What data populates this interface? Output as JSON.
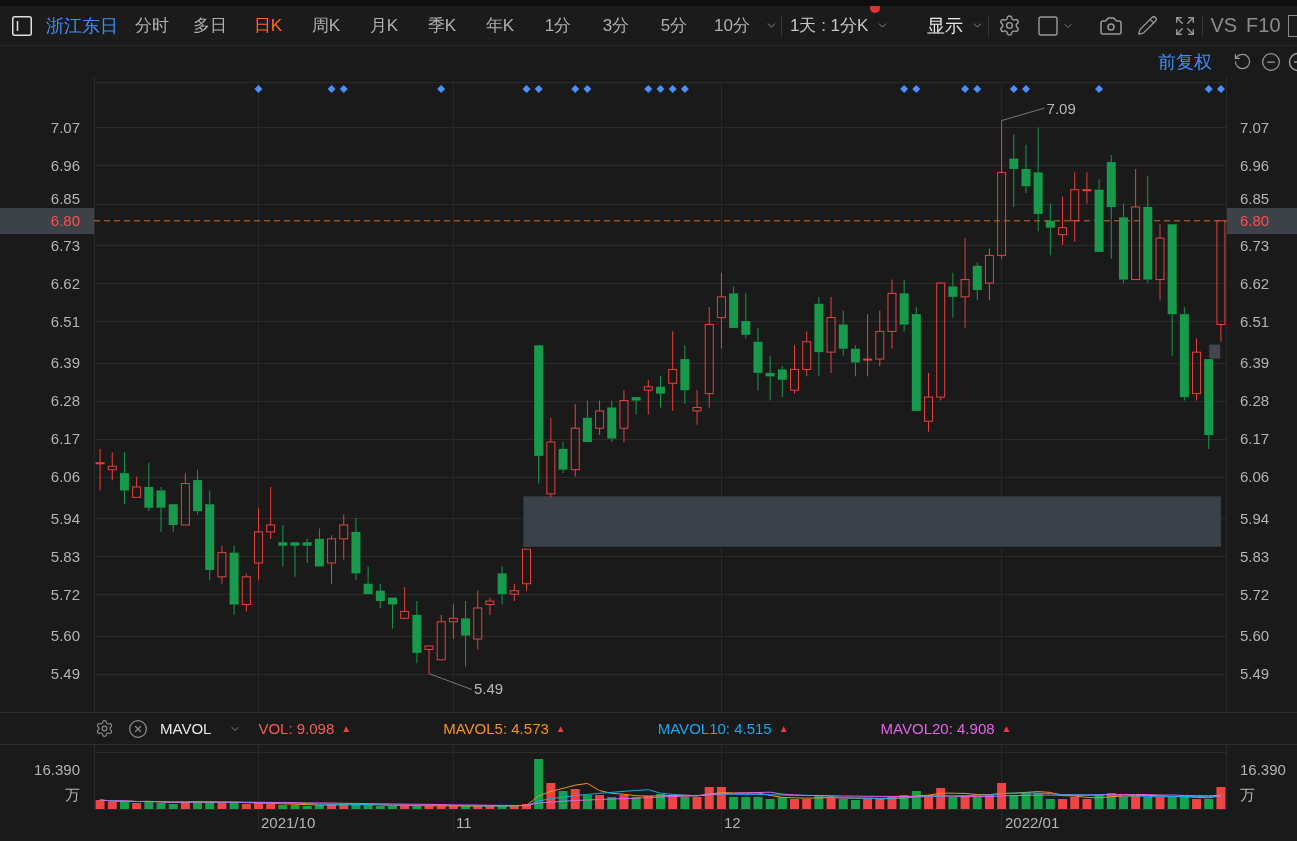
{
  "toolbar": {
    "stock_name": "浙江东日",
    "periods": [
      {
        "label": "分时",
        "selected": false
      },
      {
        "label": "多日",
        "selected": false
      },
      {
        "label": "日K",
        "selected": true
      },
      {
        "label": "周K",
        "selected": false
      },
      {
        "label": "月K",
        "selected": false
      },
      {
        "label": "季K",
        "selected": false
      },
      {
        "label": "年K",
        "selected": false
      },
      {
        "label": "1分",
        "selected": false
      },
      {
        "label": "3分",
        "selected": false
      },
      {
        "label": "5分",
        "selected": false
      },
      {
        "label": "10分",
        "selected": false
      }
    ],
    "interval": {
      "label": "1天 : 1分K",
      "alert": true
    },
    "display_menu": "显示",
    "compare": "VS",
    "f10": "F10"
  },
  "subbar": {
    "adjustment": "前复权"
  },
  "price_chart": {
    "left_axis": {
      "current_price": "6.80"
    },
    "right_axis": {
      "ticks": [
        "7.07",
        "6.96",
        "6.85",
        "6.73",
        "6.62",
        "6.51",
        "6.39",
        "6.28",
        "6.17",
        "6.06",
        "5.94",
        "5.83",
        "5.72",
        "5.60",
        "5.49"
      ],
      "current_price": "6.80"
    },
    "high_label": "7.09",
    "low_label": "5.49",
    "chart_data": {
      "type": "candlestick",
      "grid": true,
      "ylim": [
        5.379,
        7.216
      ],
      "yticks": [
        7.07,
        6.96,
        6.85,
        6.73,
        6.62,
        6.51,
        6.39,
        6.28,
        6.17,
        6.06,
        5.94,
        5.83,
        5.72,
        {
          "value": 5.6,
          "label": "5.60"
        },
        5.49
      ],
      "ref_lines": [
        {
          "axis": "y",
          "value": 6.8
        }
      ],
      "categories": [
        null,
        null,
        null,
        null,
        null,
        null,
        null,
        null,
        null,
        null,
        null,
        null,
        null,
        null,
        null,
        null,
        null,
        null,
        null,
        null,
        null,
        null,
        null,
        null,
        null,
        null,
        null,
        null,
        null,
        null,
        null,
        null,
        null,
        null,
        null,
        null,
        null,
        null,
        null,
        null,
        null,
        null,
        null,
        null,
        null,
        null,
        null,
        null,
        null,
        null,
        null,
        null,
        null,
        null,
        null,
        null,
        null,
        null,
        null,
        null,
        null,
        null,
        null,
        null,
        null,
        null,
        null,
        null,
        null,
        null,
        null,
        null,
        null,
        null,
        null,
        null,
        null,
        null,
        null,
        null,
        null,
        null,
        null,
        null,
        null,
        null,
        null,
        null,
        null,
        null,
        null,
        null,
        null
      ],
      "ohlc": [
        [
          6.1,
          6.14,
          6.02,
          6.1
        ],
        [
          6.08,
          6.13,
          6.05,
          6.09
        ],
        [
          6.07,
          6.13,
          5.98,
          6.02
        ],
        [
          6.0,
          6.06,
          6.0,
          6.03
        ],
        [
          6.03,
          6.1,
          5.96,
          5.97
        ],
        [
          6.02,
          6.03,
          5.9,
          5.97
        ],
        [
          5.98,
          5.98,
          5.9,
          5.92
        ],
        [
          5.92,
          6.07,
          5.92,
          6.04
        ],
        [
          6.05,
          6.08,
          5.95,
          5.96
        ],
        [
          5.98,
          6.02,
          5.76,
          5.79
        ],
        [
          5.77,
          5.86,
          5.75,
          5.84
        ],
        [
          5.84,
          5.86,
          5.66,
          5.69
        ],
        [
          5.69,
          5.78,
          5.67,
          5.77
        ],
        [
          5.81,
          5.97,
          5.76,
          5.9
        ],
        [
          5.9,
          6.03,
          5.88,
          5.92
        ],
        [
          5.87,
          5.92,
          5.8,
          5.86
        ],
        [
          5.87,
          5.87,
          5.77,
          5.86
        ],
        [
          5.87,
          5.88,
          5.81,
          5.86
        ],
        [
          5.88,
          5.91,
          5.8,
          5.8
        ],
        [
          5.81,
          5.89,
          5.75,
          5.88
        ],
        [
          5.88,
          5.95,
          5.82,
          5.92
        ],
        [
          5.9,
          5.94,
          5.76,
          5.78
        ],
        [
          5.75,
          5.8,
          5.72,
          5.72
        ],
        [
          5.73,
          5.75,
          5.68,
          5.7
        ],
        [
          5.71,
          5.71,
          5.62,
          5.69
        ],
        [
          5.65,
          5.74,
          5.65,
          5.67
        ],
        [
          5.66,
          5.7,
          5.52,
          5.55
        ],
        [
          5.56,
          5.57,
          5.49,
          5.57
        ],
        [
          5.53,
          5.66,
          5.53,
          5.64
        ],
        [
          5.64,
          5.69,
          5.59,
          5.65
        ],
        [
          5.65,
          5.7,
          5.51,
          5.6
        ],
        [
          5.59,
          5.73,
          5.56,
          5.68
        ],
        [
          5.69,
          5.71,
          5.66,
          5.7
        ],
        [
          5.78,
          5.8,
          5.69,
          5.72
        ],
        [
          5.72,
          5.75,
          5.7,
          5.73
        ],
        [
          5.75,
          5.85,
          5.73,
          5.85
        ],
        [
          6.44,
          6.44,
          6.04,
          6.12
        ],
        [
          6.01,
          6.23,
          6.0,
          6.16
        ],
        [
          6.14,
          6.16,
          6.07,
          6.08
        ],
        [
          6.08,
          6.27,
          6.06,
          6.2
        ],
        [
          6.23,
          6.28,
          6.16,
          6.16
        ],
        [
          6.2,
          6.28,
          6.18,
          6.25
        ],
        [
          6.26,
          6.28,
          6.16,
          6.17
        ],
        [
          6.2,
          6.31,
          6.16,
          6.28
        ],
        [
          6.29,
          6.29,
          6.24,
          6.28
        ],
        [
          6.31,
          6.34,
          6.24,
          6.32
        ],
        [
          6.32,
          6.35,
          6.26,
          6.3
        ],
        [
          6.33,
          6.48,
          6.25,
          6.37
        ],
        [
          6.4,
          6.44,
          6.27,
          6.31
        ],
        [
          6.25,
          6.31,
          6.21,
          6.26
        ],
        [
          6.3,
          6.55,
          6.26,
          6.5
        ],
        [
          6.52,
          6.65,
          6.43,
          6.58
        ],
        [
          6.59,
          6.61,
          6.49,
          6.49
        ],
        [
          6.51,
          6.59,
          6.46,
          6.47
        ],
        [
          6.45,
          6.49,
          6.31,
          6.36
        ],
        [
          6.36,
          6.41,
          6.28,
          6.35
        ],
        [
          6.37,
          6.38,
          6.29,
          6.34
        ],
        [
          6.31,
          6.44,
          6.3,
          6.37
        ],
        [
          6.37,
          6.48,
          6.35,
          6.45
        ],
        [
          6.56,
          6.58,
          6.35,
          6.42
        ],
        [
          6.42,
          6.58,
          6.36,
          6.52
        ],
        [
          6.5,
          6.54,
          6.41,
          6.43
        ],
        [
          6.43,
          6.44,
          6.35,
          6.39
        ],
        [
          6.4,
          6.53,
          6.35,
          6.4
        ],
        [
          6.4,
          6.54,
          6.38,
          6.48
        ],
        [
          6.48,
          6.63,
          6.43,
          6.59
        ],
        [
          6.59,
          6.63,
          6.48,
          6.5
        ],
        [
          6.53,
          6.55,
          6.25,
          6.25
        ],
        [
          6.22,
          6.36,
          6.19,
          6.29
        ],
        [
          6.29,
          6.62,
          6.28,
          6.62
        ],
        [
          6.61,
          6.65,
          6.52,
          6.58
        ],
        [
          6.58,
          6.75,
          6.49,
          6.63
        ],
        [
          6.67,
          6.68,
          6.57,
          6.6
        ],
        [
          6.62,
          6.72,
          6.57,
          6.7
        ],
        [
          6.7,
          7.09,
          6.69,
          6.94
        ],
        [
          6.98,
          7.05,
          6.84,
          6.95
        ],
        [
          6.95,
          7.02,
          6.88,
          6.9
        ],
        [
          6.94,
          7.07,
          6.77,
          6.82
        ],
        [
          6.8,
          6.85,
          6.7,
          6.78
        ],
        [
          6.76,
          6.87,
          6.73,
          6.78
        ],
        [
          6.8,
          6.94,
          6.74,
          6.89
        ],
        [
          6.89,
          6.94,
          6.85,
          6.89
        ],
        [
          6.89,
          6.92,
          6.71,
          6.71
        ],
        [
          6.97,
          6.99,
          6.69,
          6.84
        ],
        [
          6.81,
          6.85,
          6.62,
          6.63
        ],
        [
          6.63,
          6.95,
          6.63,
          6.84
        ],
        [
          6.84,
          6.93,
          6.62,
          6.63
        ],
        [
          6.63,
          6.79,
          6.57,
          6.75
        ],
        [
          6.79,
          6.79,
          6.41,
          6.53
        ],
        [
          6.53,
          6.55,
          6.28,
          6.29
        ],
        [
          6.3,
          6.46,
          6.28,
          6.42
        ],
        [
          6.4,
          6.4,
          6.14,
          6.18
        ],
        [
          6.5,
          6.8,
          6.45,
          6.8
        ]
      ]
    }
  },
  "indicator_bar": {
    "name": "MAVOL",
    "values": [
      {
        "text": "VOL: 9.098",
        "color": "#f25c5c",
        "mark": "▲"
      },
      {
        "text": "MAVOL5: 4.573",
        "color": "#f4921f",
        "mark": "▲"
      },
      {
        "text": "MAVOL10: 4.515",
        "color": "#1ea6ec",
        "mark": "▲"
      },
      {
        "text": "MAVOL20: 4.908",
        "color": "#e264e6",
        "mark": "▲"
      }
    ]
  },
  "volume_chart": {
    "left_axis": {
      "max": "16.390",
      "unit": "万"
    },
    "right_axis": {
      "max": "16.390",
      "unit": "万"
    }
  },
  "x_axis": {
    "labels": [
      "2021/10",
      "11",
      "12",
      "2022/01"
    ]
  }
}
